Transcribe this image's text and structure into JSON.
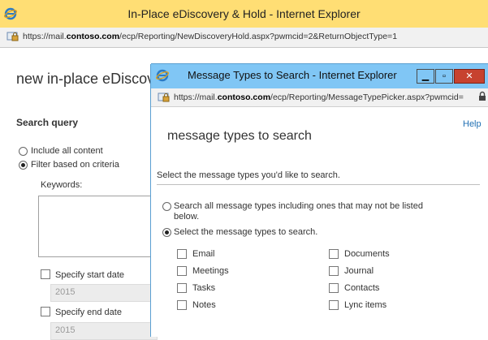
{
  "colors": {
    "back_titlebar": "#ffde74",
    "popup_titlebar": "#80c6f5",
    "close_button": "#c7422f",
    "help_link": "#1f6fb3"
  },
  "back_window": {
    "title": "In-Place eDiscovery & Hold - Internet Explorer",
    "url_prefix": "https://mail.",
    "url_domain": "contoso.com",
    "url_rest": "/ecp/Reporting/NewDiscoveryHold.aspx?pwmcid=2&ReturnObjectType=1",
    "page_heading": "new in-place eDiscov",
    "search_query_heading": "Search query",
    "include_all_label": "Include all content",
    "filter_label": "Filter based on criteria",
    "keywords_label": "Keywords:",
    "start_date_label": "Specify start date",
    "start_year": "2015",
    "end_date_label": "Specify end date",
    "end_year": "2015"
  },
  "popup": {
    "title": "Message Types to Search - Internet Explorer",
    "url_prefix": "https://mail.",
    "url_domain": "contoso.com",
    "url_rest": "/ecp/Reporting/MessageTypePicker.aspx?pwmcid=",
    "help": "Help",
    "heading": "message types to search",
    "instruction": "Select the message types you'd like to search.",
    "option_all_line1": "Search all message types including ones that may not be listed",
    "option_all_line2": "below.",
    "option_select": "Select the message types to search.",
    "types_left": [
      "Email",
      "Meetings",
      "Tasks",
      "Notes"
    ],
    "types_right": [
      "Documents",
      "Journal",
      "Contacts",
      "Lync items"
    ]
  }
}
